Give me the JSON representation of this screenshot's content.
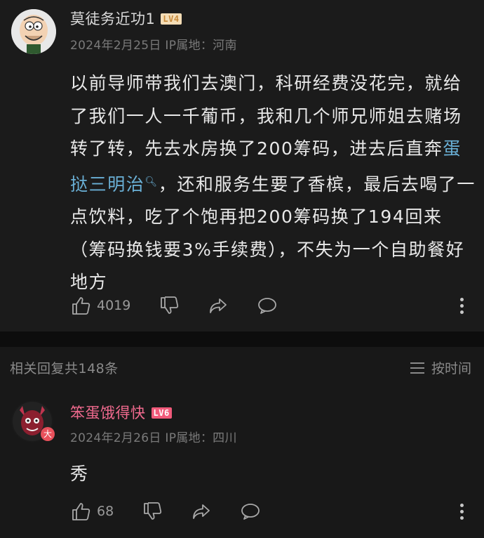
{
  "comment": {
    "username": "莫徒务近功1",
    "level": "LV4",
    "meta": "2024年2月25日 IP属地：河南",
    "text_before": "以前导师带我们去澳门，科研经费没花完，就给了我们一人一千葡币，我和几个师兄师姐去赌场转了转，先去水房换了200筹码，进去后直奔",
    "keyword": "蛋挞三明治",
    "text_after": "，还和服务生要了香槟，最后去喝了一点饮料，吃了个饱再把200筹码换了194回来（筹码换钱要3%手续费），不失为一个自助餐好地方",
    "likes": "4019"
  },
  "replies_header": {
    "count_label": "相关回复共148条",
    "sort_label": "按时间"
  },
  "reply": {
    "username": "笨蛋饿得快",
    "level": "LV6",
    "meta": "2024年2月26日 IP属地：四川",
    "text": "秀",
    "likes": "68",
    "avatar_badge": "大"
  },
  "colors": {
    "background": "#181818",
    "link": "#6ab0d6",
    "reply_username": "#f06a8e",
    "lv4_badge": "#f4ddb6",
    "lv6_badge": "#f05a7a"
  },
  "icons": [
    "thumb-up-icon",
    "thumb-down-icon",
    "share-icon",
    "comment-bubble-icon",
    "more-vertical-icon",
    "sort-lines-icon",
    "search-icon"
  ]
}
